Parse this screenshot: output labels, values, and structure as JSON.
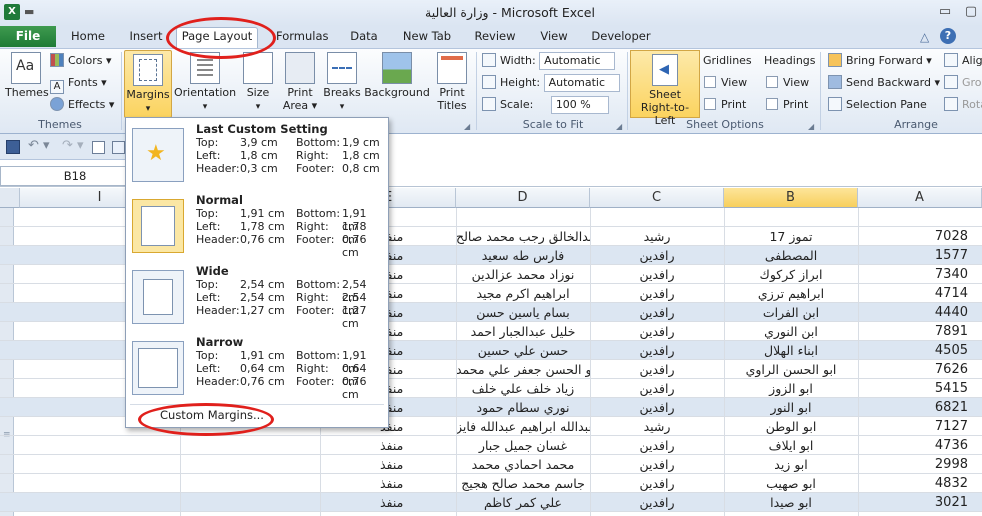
{
  "window": {
    "title": "وزارة العالية - Microsoft Excel",
    "app_icon": "X",
    "controls": {
      "minimize": "▭",
      "restore": "▢",
      "close": "✕"
    }
  },
  "ribbon_tabs": [
    {
      "label": "File"
    },
    {
      "label": "Home"
    },
    {
      "label": "Insert"
    },
    {
      "label": "Page Layout"
    },
    {
      "label": "Formulas"
    },
    {
      "label": "Data"
    },
    {
      "label": "New Tab"
    },
    {
      "label": "Review"
    },
    {
      "label": "View"
    },
    {
      "label": "Developer"
    }
  ],
  "ribbon_right_icons": {
    "help": "?",
    "collapse": "△"
  },
  "themes_group": {
    "label": "Themes",
    "themes_btn": "Themes",
    "colors": "Colors",
    "fonts": "Fonts",
    "effects": "Effects"
  },
  "page_setup": {
    "margins": "Margins",
    "orientation": "Orientation",
    "size": "Size",
    "print_area_1": "Print",
    "print_area_2": "Area",
    "breaks": "Breaks",
    "background": "Background",
    "print_titles_1": "Print",
    "print_titles_2": "Titles"
  },
  "scale_to_fit": {
    "label": "Scale to Fit",
    "width_label": "Width:",
    "width_value": "Automatic",
    "height_label": "Height:",
    "height_value": "Automatic",
    "scale_label": "Scale:",
    "scale_value": "100 %"
  },
  "sheet_options": {
    "label": "Sheet Options",
    "rtl_1": "Sheet",
    "rtl_2": "Right-to-Left",
    "gridlines": "Gridlines",
    "headings": "Headings",
    "view": "View",
    "print": "Print"
  },
  "arrange": {
    "label": "Arrange",
    "bring_forward": "Bring Forward",
    "send_backward": "Send Backward",
    "selection_pane": "Selection Pane",
    "align": "Alig",
    "group": "Gro",
    "rotate": "Rota"
  },
  "name_box": "B18",
  "margins_menu": {
    "options": [
      {
        "title": "Last Custom Setting",
        "top": "3,9 cm",
        "bottom": "1,9 cm",
        "left": "1,8 cm",
        "right": "1,8 cm",
        "header": "0,3 cm",
        "footer": "0,8 cm"
      },
      {
        "title": "Normal",
        "top": "1,91 cm",
        "bottom": "1,91 cm",
        "left": "1,78 cm",
        "right": "1,78 cm",
        "header": "0,76 cm",
        "footer": "0,76 cm"
      },
      {
        "title": "Wide",
        "top": "2,54 cm",
        "bottom": "2,54 cm",
        "left": "2,54 cm",
        "right": "2,54 cm",
        "header": "1,27 cm",
        "footer": "1,27 cm"
      },
      {
        "title": "Narrow",
        "top": "1,91 cm",
        "bottom": "1,91 cm",
        "left": "0,64 cm",
        "right": "0,64 cm",
        "header": "0,76 cm",
        "footer": "0,76 cm"
      }
    ],
    "labels": {
      "top": "Top:",
      "bottom": "Bottom:",
      "left": "Left:",
      "right": "Right:",
      "header": "Header:",
      "footer": "Footer:"
    },
    "custom": "Custom Margins..."
  },
  "columns": [
    "I",
    "E",
    "D",
    "C",
    "B",
    "A"
  ],
  "rows": [
    {
      "e": "",
      "d": "",
      "c": "",
      "b": "",
      "a": ""
    },
    {
      "e": "منفذ",
      "d": "عبدالخالق رجب محمد صالح",
      "c": "رشيد",
      "b": "تموز 17",
      "a": "7028"
    },
    {
      "e": "منفذ",
      "d": "فارس طه سعيد",
      "c": "رافدين",
      "b": "المصطفى",
      "a": "1577"
    },
    {
      "e": "منفذ",
      "d": "نوزاد محمد عزالدين",
      "c": "رافدين",
      "b": "ابراز كركوك",
      "a": "7340"
    },
    {
      "e": "منفذ",
      "d": "ابراهيم اكرم مجيد",
      "c": "رافدين",
      "b": "ابراهيم ترزي",
      "a": "4714"
    },
    {
      "e": "منفذ",
      "d": "بسام ياسين حسن",
      "c": "رافدين",
      "b": "ابن الفرات",
      "a": "4440"
    },
    {
      "e": "منفذ",
      "d": "خليل عبدالجبار احمد",
      "c": "رافدين",
      "b": "ابن النوري",
      "a": "7891"
    },
    {
      "e": "منفذ",
      "d": "حسن علي حسين",
      "c": "رافدين",
      "b": "ابناء الهلال",
      "a": "4505"
    },
    {
      "e": "منفذ",
      "d": "ابو الحسن جعفر علي محمد",
      "c": "رافدين",
      "b": "ابو الحسن الراوي",
      "a": "7626"
    },
    {
      "e": "منفذ",
      "d": "زياد خلف علي خلف",
      "c": "رافدين",
      "b": "ابو الزوز",
      "a": "5415"
    },
    {
      "e": "منفذ",
      "d": "نوري سطام حمود",
      "c": "رافدين",
      "b": "ابو النور",
      "a": "6821"
    },
    {
      "e": "منفذ",
      "d": "عبدالله ابراهيم عبدالله فايز",
      "c": "رشيد",
      "b": "ابو الوطن",
      "a": "7127"
    },
    {
      "e": "منفذ",
      "d": "غسان جميل جبار",
      "c": "رافدين",
      "b": "ابو ايلاف",
      "a": "4736"
    },
    {
      "e": "منفذ",
      "d": "محمد احمادي محمد",
      "c": "رافدين",
      "b": "ابو زيد",
      "a": "2998"
    },
    {
      "e": "منفذ",
      "d": "جاسم محمد صالح هجيج",
      "c": "رافدين",
      "b": "ابو صهيب",
      "a": "4832"
    },
    {
      "e": "منفذ",
      "d": "علي كمر كاظم",
      "c": "رافدين",
      "b": "ابو صيدا",
      "a": "3021"
    }
  ]
}
